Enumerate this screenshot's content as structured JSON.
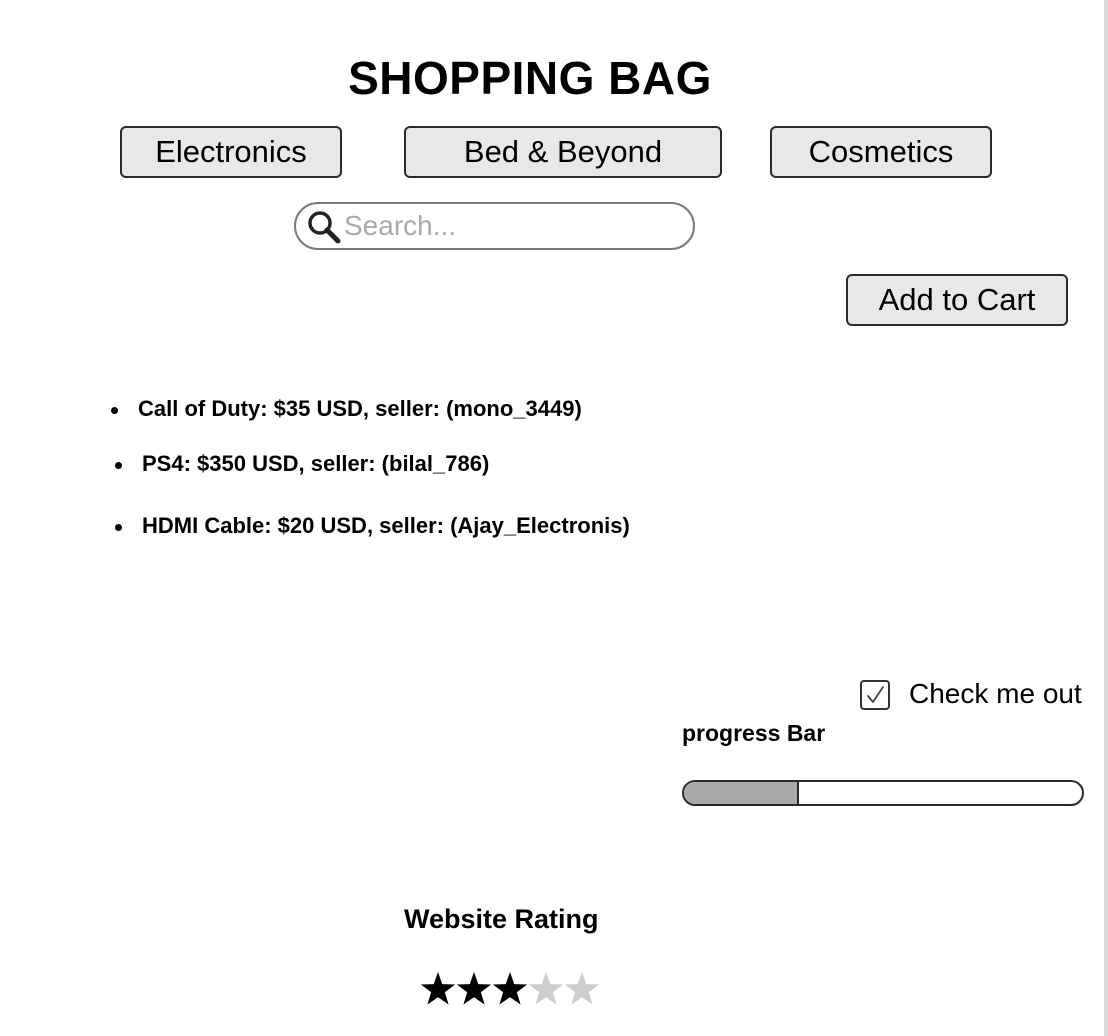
{
  "header": {
    "title": "SHOPPING BAG"
  },
  "categories": [
    {
      "label": "Electronics"
    },
    {
      "label": "Bed & Beyond"
    },
    {
      "label": "Cosmetics"
    }
  ],
  "search": {
    "value": "",
    "placeholder": "Search...",
    "icon": "search-icon"
  },
  "cart": {
    "add_label": "Add to Cart"
  },
  "products": [
    {
      "text": "Call of Duty: $35 USD, seller: (mono_3449)"
    },
    {
      "text": "PS4: $350 USD, seller: (bilal_786)"
    },
    {
      "text": "HDMI Cable: $20 USD, seller: (Ajay_Electronis)"
    }
  ],
  "checkout": {
    "label": "Check me out",
    "checked": true
  },
  "progress": {
    "label": "progress Bar",
    "value_percent": 29
  },
  "rating": {
    "title": "Website Rating",
    "value": 3,
    "max": 5,
    "filled_color": "#000000",
    "empty_color": "#cccccc"
  },
  "colors": {
    "button_bg": "#e8e8e8",
    "progress_fill": "#a9a9a9"
  }
}
